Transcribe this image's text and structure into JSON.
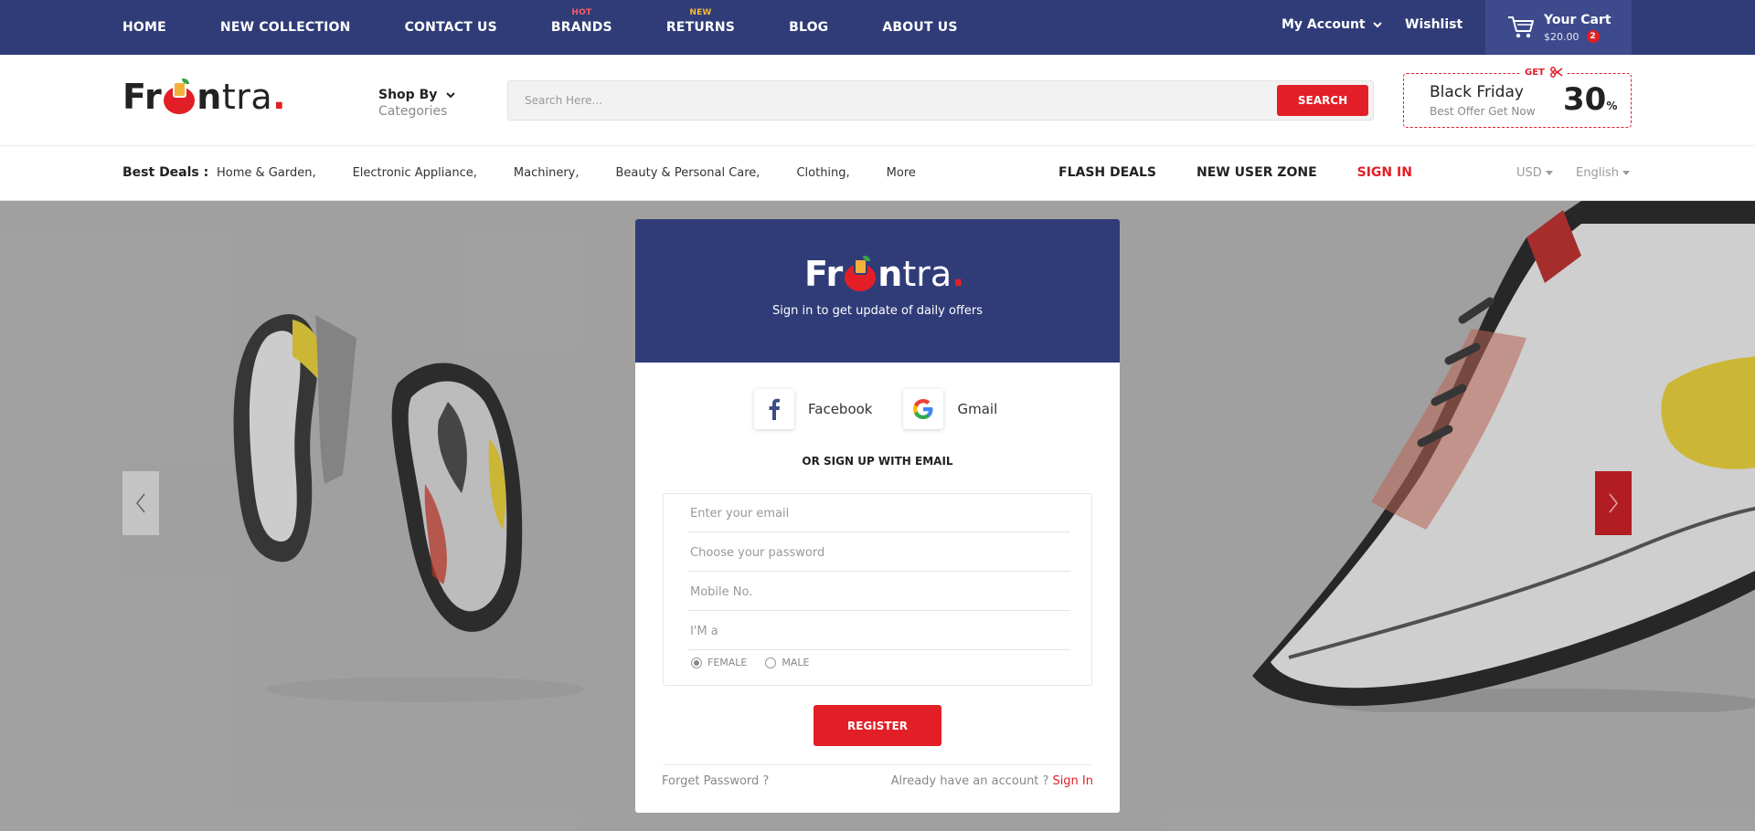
{
  "topbar": {
    "nav": [
      {
        "label": "HOME",
        "tag": "",
        "tag_type": ""
      },
      {
        "label": "NEW COLLECTION",
        "tag": "",
        "tag_type": ""
      },
      {
        "label": "CONTACT US",
        "tag": "",
        "tag_type": ""
      },
      {
        "label": "BRANDS",
        "tag": "HOT",
        "tag_type": "hot"
      },
      {
        "label": "RETURNS",
        "tag": "NEW",
        "tag_type": "new"
      },
      {
        "label": "BLOG",
        "tag": "",
        "tag_type": ""
      },
      {
        "label": "ABOUT US",
        "tag": "",
        "tag_type": ""
      }
    ],
    "account": "My Account",
    "wishlist": "Wishlist",
    "cart": {
      "title": "Your Cart",
      "amount": "$20.00",
      "count": "2"
    }
  },
  "header": {
    "logo": {
      "part1": "Fr",
      "part2": "n",
      "part3": "tra",
      "dot": "."
    },
    "shop_by": {
      "title": "Shop By",
      "subtitle": "Categories"
    },
    "search": {
      "placeholder": "Search Here...",
      "button": "SEARCH"
    },
    "promo": {
      "get": "GET",
      "title": "Black Friday",
      "subtitle": "Best Offer Get Now",
      "value": "30",
      "unit": "%"
    }
  },
  "deals": {
    "title": "Best Deals :",
    "categories": [
      "Home & Garden,",
      "Electronic Appliance,",
      "Machinery,",
      "Beauty & Personal Care,",
      "Clothing,",
      "More"
    ],
    "links": {
      "flash": "FLASH DEALS",
      "new_user": "NEW USER ZONE",
      "sign_in": "SIGN IN"
    },
    "currency": "USD",
    "language": "English"
  },
  "modal": {
    "logo": {
      "part1": "Fr",
      "part2": "n",
      "part3": "tra",
      "dot": "."
    },
    "tagline": "Sign in to get update of daily offers",
    "social": {
      "facebook": "Facebook",
      "gmail": "Gmail"
    },
    "or_text": "OR SIGN UP WITH EMAIL",
    "fields": {
      "email": "Enter your email",
      "password": "Choose your password",
      "mobile": "Mobile No.",
      "iam": "I'M a"
    },
    "gender": {
      "female": "FEMALE",
      "male": "MALE",
      "selected": "female"
    },
    "register": "REGISTER",
    "forgot": "Forget Password ?",
    "already": "Already have an account ?",
    "sign_in": "Sign In"
  },
  "colors": {
    "navy": "#303c78",
    "red": "#e21f26",
    "hero_bg": "#ababab"
  }
}
